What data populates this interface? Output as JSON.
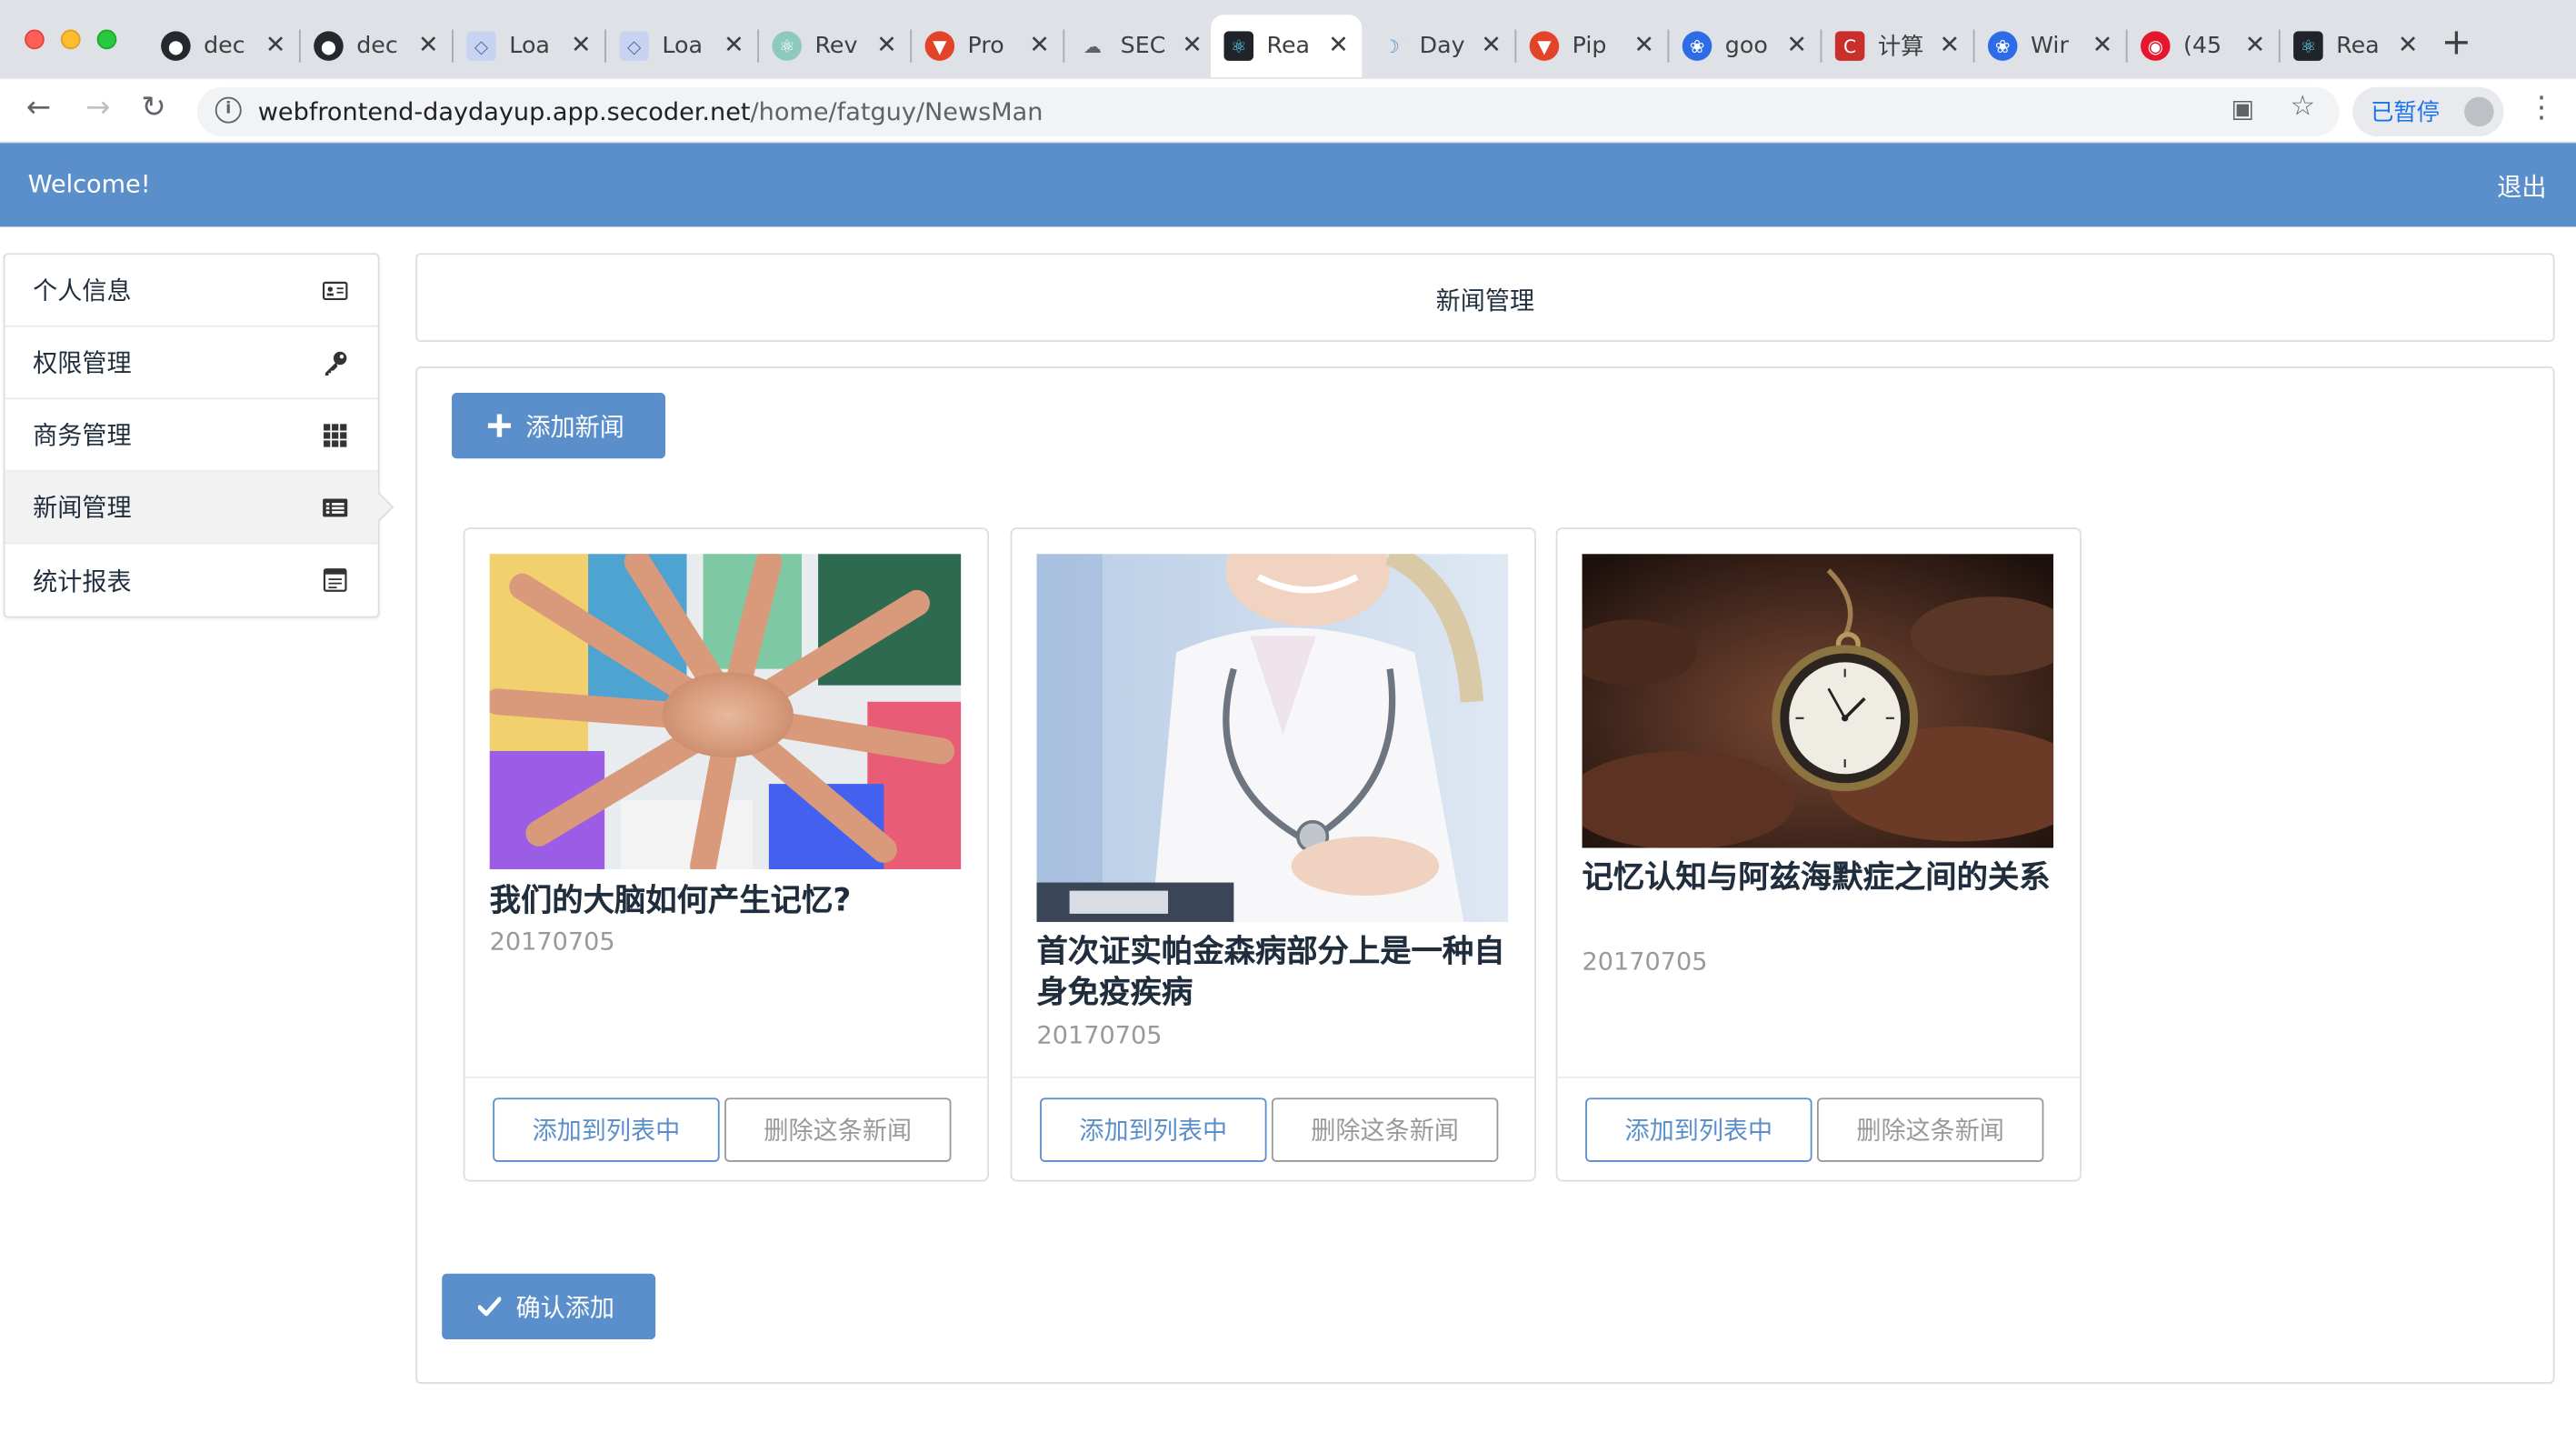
{
  "browser": {
    "tabs": [
      {
        "label": "dec",
        "icon": "github-icon"
      },
      {
        "label": "dec",
        "icon": "github-icon"
      },
      {
        "label": "Loa",
        "icon": "page-icon"
      },
      {
        "label": "Loa",
        "icon": "page-icon"
      },
      {
        "label": "Rev",
        "icon": "react-icon"
      },
      {
        "label": "Pro",
        "icon": "gitlab-icon"
      },
      {
        "label": "SEC",
        "icon": "cloud-icon"
      },
      {
        "label": "Rea",
        "icon": "react-icon",
        "active": true
      },
      {
        "label": "Day",
        "icon": "moon-icon"
      },
      {
        "label": "Pip",
        "icon": "gitlab-icon"
      },
      {
        "label": "goo",
        "icon": "baidu-icon"
      },
      {
        "label": "计算",
        "icon": "c-icon"
      },
      {
        "label": "Wir",
        "icon": "baidu-icon"
      },
      {
        "label": "(45",
        "icon": "weibo-icon"
      },
      {
        "label": "Rea",
        "icon": "react-icon"
      }
    ],
    "url_host": "webfrontend-daydayup.app.secoder.net",
    "url_path": "/home/fatguy/NewsMan",
    "paused_label": "已暂停"
  },
  "header": {
    "welcome": "Welcome!",
    "logout": "退出",
    "color": "#5b8fcb"
  },
  "sidebar": {
    "items": [
      {
        "label": "个人信息",
        "icon": "id-card-icon"
      },
      {
        "label": "权限管理",
        "icon": "key-icon"
      },
      {
        "label": "商务管理",
        "icon": "grid-icon"
      },
      {
        "label": "新闻管理",
        "icon": "newspaper-icon",
        "active": true
      },
      {
        "label": "统计报表",
        "icon": "report-icon"
      }
    ]
  },
  "page": {
    "title": "新闻管理",
    "add_news_label": "添加新闻",
    "confirm_label": "确认添加"
  },
  "news": [
    {
      "title": "我们的大脑如何产生记忆?",
      "date": "20170705",
      "image": "hands-together-photo",
      "add_label": "添加到列表中",
      "delete_label": "删除这条新闻"
    },
    {
      "title": "首次证实帕金森病部分上是一种自身免疫疾病",
      "date": "20170705",
      "image": "doctor-photo",
      "add_label": "添加到列表中",
      "delete_label": "删除这条新闻"
    },
    {
      "title": "记忆认知与阿兹海默症之间的关系",
      "date": "20170705",
      "image": "pocket-watch-photo",
      "add_label": "添加到列表中",
      "delete_label": "删除这条新闻"
    }
  ]
}
